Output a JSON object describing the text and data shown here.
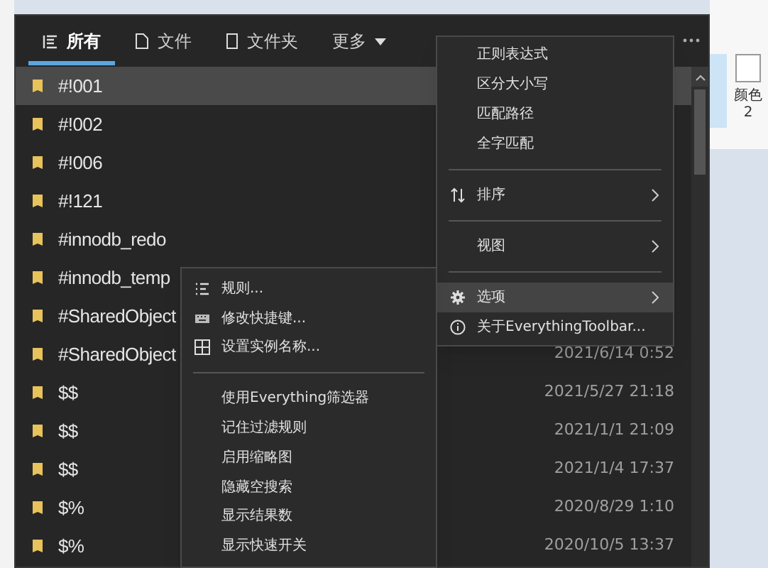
{
  "ribbon": {
    "color_label": "颜色2"
  },
  "tabs": [
    {
      "label": "所有",
      "kind": "all",
      "selected": true
    },
    {
      "label": "文件",
      "kind": "file",
      "selected": false
    },
    {
      "label": "文件夹",
      "kind": "folder",
      "selected": false
    },
    {
      "label": "更多",
      "kind": "dropdown",
      "selected": false
    }
  ],
  "results": [
    {
      "name": "#!001",
      "selected": true
    },
    {
      "name": "#!002",
      "selected": false
    },
    {
      "name": "#!006",
      "selected": false
    },
    {
      "name": "#!121",
      "selected": false
    },
    {
      "name": "#innodb_redo",
      "selected": false
    },
    {
      "name": "#innodb_temp",
      "selected": false
    },
    {
      "name": "#SharedObject",
      "selected": false
    },
    {
      "name": "#SharedObject",
      "selected": false,
      "date": "2021/6/14 0:52"
    },
    {
      "name": "$$",
      "selected": false,
      "date": "2021/5/27 21:18"
    },
    {
      "name": "$$",
      "selected": false,
      "date": "2021/1/1 21:09"
    },
    {
      "name": "$$",
      "selected": false,
      "date": "2021/1/4 17:37"
    },
    {
      "name": "$%",
      "selected": false,
      "date": "2020/8/29 1:10"
    },
    {
      "name": "$%",
      "selected": false,
      "date": "2020/10/5 13:37"
    }
  ],
  "options_menu": [
    {
      "kind": "plain",
      "label": "正则表达式",
      "highlighted": false
    },
    {
      "kind": "plain",
      "label": "区分大小写",
      "highlighted": false
    },
    {
      "kind": "plain",
      "label": "匹配路径",
      "highlighted": false
    },
    {
      "kind": "plain",
      "label": "全字匹配",
      "highlighted": false
    },
    {
      "kind": "separator"
    },
    {
      "kind": "sort",
      "label": "排序",
      "submenu": true,
      "highlighted": false
    },
    {
      "kind": "separator"
    },
    {
      "kind": "plain",
      "label": "视图",
      "submenu": true,
      "highlighted": false
    },
    {
      "kind": "separator"
    },
    {
      "kind": "gear",
      "label": "选项",
      "submenu": true,
      "highlighted": true
    },
    {
      "kind": "info",
      "label": "关于EverythingToolbar...",
      "highlighted": false
    }
  ],
  "settings_submenu": [
    {
      "kind": "rules",
      "label": "规则...",
      "highlighted": false
    },
    {
      "kind": "keyboard",
      "label": "修改快捷键...",
      "highlighted": false
    },
    {
      "kind": "grid",
      "label": "设置实例名称...",
      "highlighted": false
    },
    {
      "kind": "separator"
    },
    {
      "kind": "plain",
      "label": "使用Everything筛选器",
      "highlighted": false
    },
    {
      "kind": "plain",
      "label": "记住过滤规则",
      "highlighted": false
    },
    {
      "kind": "plain",
      "label": "启用缩略图",
      "highlighted": false
    },
    {
      "kind": "plain",
      "label": "隐藏空搜索",
      "highlighted": false
    },
    {
      "kind": "plain",
      "label": "显示结果数",
      "highlighted": false
    },
    {
      "kind": "plain",
      "label": "显示快速开关",
      "highlighted": false
    }
  ]
}
